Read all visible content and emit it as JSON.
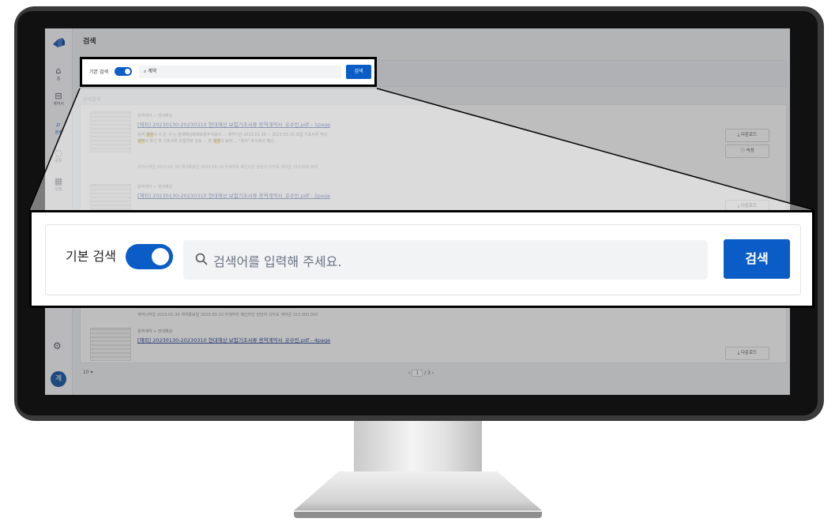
{
  "app": {
    "page_title": "검색",
    "sidebar": {
      "items": [
        {
          "label": "홈",
          "icon": "home-icon"
        },
        {
          "label": "계약서",
          "icon": "briefcase-icon"
        },
        {
          "label": "검색",
          "icon": "search-icon"
        },
        {
          "label": "공유",
          "icon": "share-icon"
        },
        {
          "label": "일정",
          "icon": "calendar-icon"
        }
      ],
      "avatar_initial": "계"
    },
    "mini_search": {
      "label": "기본 검색",
      "query": "계약",
      "button": "검색"
    },
    "results_header": "검색결과",
    "results": [
      {
        "category": "용역계약 > 현대해상",
        "title": "[해외] 20230130-20230310 현대해상 보험기초서류 용역계약서_유수빈.pdf - 1page",
        "snippet_a": "용역 ",
        "snippet_mark_a": "계약",
        "snippet_b": "서 이 문 서 는 현대해상화재보험주식회사 ... 계약기간 2023.01.30 ~ 2023.03.10 보험 기초서류 작성",
        "snippet_mark_b": "계약",
        "snippet_c": "서 확인 및 기초서류 보험약관 검토 ... 본 ",
        "snippet_mark_c": "계약",
        "snippet_d": "의 효력 ... \"회사\" 주식회사 메인...",
        "meta": "계약시작일 2023-01-30   계약종료일 2023-03-10   주계약자 메인라인   담당자 이두호   계약금 153,000,000",
        "download": "다운로드",
        "info": "속성"
      },
      {
        "category": "용역계약 > 현대해상",
        "title": "[해외] 20230130-20230310 현대해상 보험기초서류 용역계약서_유수빈.pdf - 2page",
        "download": "다운로드"
      },
      {
        "category": "용역계약 > 현대해상",
        "title": "[해외] 20230130-20230310 현대해상 보험기초서류 용역계약서_유수빈.pdf - 4page",
        "meta": "계약시작일 2023-01-30   계약종료일 2023-03-10   주계약자 메인라인   담당자 이두호   계약금 153,000,000",
        "download": "다운로드"
      }
    ],
    "pagination": {
      "per_page": "10",
      "current": "1",
      "total": "/ 3"
    }
  },
  "zoom": {
    "label": "기본 검색",
    "placeholder": "검색어를 입력해 주세요.",
    "button": "검색"
  },
  "colors": {
    "accent": "#0a5cc7",
    "highlight": "#f4e27a"
  }
}
